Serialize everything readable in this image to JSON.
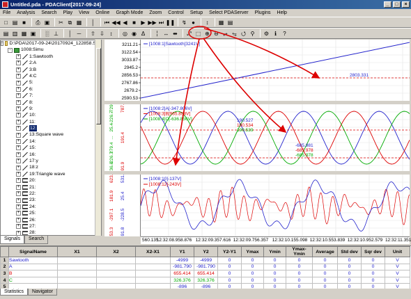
{
  "window": {
    "title": "Untitled.pda - PDAClient[2017-09-24]"
  },
  "menu": [
    "File",
    "Analysis",
    "Search",
    "Play",
    "View",
    "Online",
    "Graph Mode",
    "Zoom",
    "Control",
    "Setup",
    "Select PDAServer",
    "Plugins",
    "Help"
  ],
  "toolbar1": [
    {
      "name": "new-icon",
      "glyph": "□"
    },
    {
      "name": "open-icon",
      "glyph": "▤"
    },
    {
      "name": "save-icon",
      "glyph": "■"
    },
    {
      "name": "sep"
    },
    {
      "name": "print-icon",
      "glyph": "⎙"
    },
    {
      "name": "preview-icon",
      "glyph": "▣"
    },
    {
      "name": "sep"
    },
    {
      "name": "cut-icon",
      "glyph": "✂"
    },
    {
      "name": "copy-icon",
      "glyph": "⧉"
    },
    {
      "name": "paste-icon",
      "glyph": "▦"
    },
    {
      "name": "sep"
    },
    {
      "name": "marker-icon",
      "glyph": "│"
    },
    {
      "name": "sep"
    },
    {
      "name": "first-icon",
      "glyph": "⏮"
    },
    {
      "name": "rewind-icon",
      "glyph": "◀◀"
    },
    {
      "name": "prev-icon",
      "glyph": "◀"
    },
    {
      "name": "stop-icon",
      "glyph": "■"
    },
    {
      "name": "play-icon",
      "glyph": "▶"
    },
    {
      "name": "forward-icon",
      "glyph": "▶▶"
    },
    {
      "name": "last-icon",
      "glyph": "⏭"
    },
    {
      "name": "pause-icon",
      "glyph": "❚❚"
    },
    {
      "name": "sep"
    },
    {
      "name": "trigger-icon",
      "glyph": "↯"
    },
    {
      "name": "record-icon",
      "glyph": "●"
    },
    {
      "name": "sep"
    },
    {
      "name": "cursor-icon",
      "glyph": "↕"
    },
    {
      "name": "sep"
    },
    {
      "name": "grid-icon",
      "glyph": "▦"
    },
    {
      "name": "table-icon",
      "glyph": "▤"
    }
  ],
  "toolbar2": [
    {
      "name": "layout1-icon",
      "glyph": "▤"
    },
    {
      "name": "layout2-icon",
      "glyph": "▥"
    },
    {
      "name": "layout3-icon",
      "glyph": "▦"
    },
    {
      "name": "layout4-icon",
      "glyph": "▣"
    },
    {
      "name": "sep"
    },
    {
      "name": "chart-icon",
      "glyph": "░"
    },
    {
      "name": "xy-icon",
      "glyph": "⊥"
    },
    {
      "name": "sep"
    },
    {
      "name": "vertical-marker-icon",
      "glyph": "│"
    },
    {
      "name": "horizontal-marker-icon",
      "glyph": "─"
    },
    {
      "name": "sep"
    },
    {
      "name": "scale-up-icon",
      "glyph": "⇧"
    },
    {
      "name": "scale-down-icon",
      "glyph": "⇩"
    },
    {
      "name": "auto-scale-icon",
      "glyph": "↕"
    },
    {
      "name": "sep"
    },
    {
      "name": "time-marker-icon",
      "glyph": "◎"
    },
    {
      "name": "value-marker-icon",
      "glyph": "◉"
    },
    {
      "name": "delta-icon",
      "glyph": "Δ"
    },
    {
      "name": "sep"
    },
    {
      "name": "cursor-vertical-icon",
      "glyph": "╎"
    },
    {
      "name": "cursor-horizontal-icon",
      "glyph": "↔"
    },
    {
      "name": "cursor-cross-icon",
      "glyph": "⬌"
    },
    {
      "name": "sep"
    },
    {
      "name": "zoom-fit-icon",
      "glyph": "⤢"
    },
    {
      "name": "zoom-box-icon",
      "glyph": "⬚"
    },
    {
      "name": "zoom-in-icon",
      "glyph": "⊕"
    },
    {
      "name": "zoom-out-icon",
      "glyph": "⊖"
    },
    {
      "name": "zoom-x-icon",
      "glyph": "⥂"
    },
    {
      "name": "zoom-y-icon",
      "glyph": "⥃"
    },
    {
      "name": "zoom-reset-icon",
      "glyph": "⭯"
    },
    {
      "name": "search-icon",
      "glyph": "⚲"
    },
    {
      "name": "sep"
    },
    {
      "name": "settings-icon",
      "glyph": "⚙"
    },
    {
      "name": "info-icon",
      "glyph": "ℹ"
    },
    {
      "name": "help-icon",
      "glyph": "?"
    }
  ],
  "tree": {
    "root": "D:\\PDA\\2017-09-24\\20170924_122858.Sim",
    "node": "1008:Simu",
    "items": [
      {
        "label": "1:Sawtooth",
        "type": "analog"
      },
      {
        "label": "2:A",
        "type": "analog"
      },
      {
        "label": "3:B",
        "type": "analog"
      },
      {
        "label": "4:C",
        "type": "analog"
      },
      {
        "label": "5:",
        "type": "analog"
      },
      {
        "label": "6:",
        "type": "analog"
      },
      {
        "label": "7:",
        "type": "analog"
      },
      {
        "label": "8:",
        "type": "analog"
      },
      {
        "label": "9:",
        "type": "analog"
      },
      {
        "label": "10:",
        "type": "analog"
      },
      {
        "label": "11:",
        "type": "analog"
      },
      {
        "label": "12:",
        "type": "analog",
        "selected": true
      },
      {
        "label": "13:Square wave",
        "type": "analog"
      },
      {
        "label": "14:",
        "type": "analog"
      },
      {
        "label": "15:",
        "type": "analog"
      },
      {
        "label": "16:",
        "type": "analog"
      },
      {
        "label": "17:y",
        "type": "analog"
      },
      {
        "label": "18:z",
        "type": "analog"
      },
      {
        "label": "19:Triangle wave",
        "type": "analog"
      },
      {
        "label": "20:",
        "type": "digital"
      },
      {
        "label": "21:",
        "type": "digital"
      },
      {
        "label": "22:",
        "type": "digital"
      },
      {
        "label": "23:",
        "type": "digital"
      },
      {
        "label": "24:",
        "type": "digital"
      },
      {
        "label": "25:",
        "type": "digital"
      },
      {
        "label": "26:",
        "type": "digital"
      },
      {
        "label": "27:",
        "type": "digital"
      },
      {
        "label": "28:",
        "type": "digital"
      },
      {
        "label": "29:",
        "type": "digital"
      }
    ],
    "tabs": [
      "Signals",
      "Search"
    ]
  },
  "plot1": {
    "legend": "[1008:1]Sawtooth[3241V]",
    "ticks": [
      "3211.21",
      "3122.54",
      "3033.87",
      "2945.2",
      "2856.53",
      "2767.86",
      "2679.2",
      "2590.53"
    ],
    "marker_value": "2803.331",
    "colors": {
      "line": "#2222cc",
      "marker": "#dd0000",
      "arrow": "#dd0000"
    }
  },
  "plot2": {
    "legends": [
      {
        "text": "[1008:2]A[-347.806V]",
        "color": "#2222cc"
      },
      {
        "text": "[1008:3]B[965.858V]",
        "color": "#dd0000"
      },
      {
        "text": "[1008:4]C[-636.856V]",
        "color": "#00aa00"
      }
    ],
    "left_ticks": [
      "-736.8",
      "-226.7",
      "279.4",
      "...",
      "25.4",
      "-226.7",
      "-729.1"
    ],
    "center_ticks": [
      "-491.9",
      "191.4",
      "787.6"
    ],
    "readout_a": [
      {
        "text": "190.527",
        "color": "#2222cc"
      },
      {
        "text": "190.534",
        "color": "#dd0000"
      },
      {
        "text": "190.539",
        "color": "#00aa00"
      }
    ],
    "readout_b": [
      {
        "text": "-685.981",
        "color": "#2222cc"
      },
      {
        "text": "-685.978",
        "color": "#dd0000"
      },
      {
        "text": "-685.978",
        "color": "#00aa00"
      }
    ]
  },
  "plot3": {
    "legends": [
      {
        "text": "[1008:10]-137V]",
        "color": "#2222cc"
      },
      {
        "text": "[1008:12]-243V]",
        "color": "#dd0000"
      }
    ],
    "left_ticks": [
      "-753.3",
      "-297.1",
      "181.9",
      "623.8"
    ],
    "mid_ticks": [
      "-491.8",
      "-228.5",
      "25.4",
      "531.8"
    ]
  },
  "xaxis": [
    "560.135",
    "12:32:08.958.876",
    "12:32:09.357.616",
    "12:32:09.756.357",
    "12:32:10.155.098",
    "12:32:10.553.839",
    "12:32:10.952.579",
    "12:32:11.351.320"
  ],
  "table": {
    "columns": [
      "",
      "SignalName",
      "X1",
      "X2",
      "X2-X1",
      "Y1",
      "Y2",
      "Y2-Y1",
      "Ymax",
      "Ymin",
      "Ymax-Ymin",
      "Average",
      "Std dev",
      "Sqr dev",
      "Unit"
    ],
    "rows": [
      {
        "n": "1",
        "name": "Sawtooth",
        "color": "#2222cc",
        "x1": "",
        "x2": "",
        "dx": "",
        "y1": "-4999",
        "y2": "-4999",
        "dy": "0",
        "ymax": "0",
        "ymin": "0",
        "range": "0",
        "avg": "0",
        "std": "0",
        "sqr": "0",
        "unit": "V"
      },
      {
        "n": "2",
        "name": "A",
        "color": "#2222cc",
        "x1": "",
        "x2": "",
        "dx": "",
        "y1": "-981.790",
        "y2": "-981.790",
        "dy": "0",
        "ymax": "0",
        "ymin": "0",
        "range": "0",
        "avg": "0",
        "std": "0",
        "sqr": "0",
        "unit": "V"
      },
      {
        "n": "3",
        "name": "B",
        "color": "#dd0000",
        "x1": "",
        "x2": "",
        "dx": "",
        "y1": "655.414",
        "y2": "655.414",
        "dy": "0",
        "ymax": "0",
        "ymin": "0",
        "range": "0",
        "avg": "0",
        "std": "0",
        "sqr": "0",
        "unit": "V"
      },
      {
        "n": "4",
        "name": "C",
        "color": "#00aa00",
        "x1": "",
        "x2": "",
        "dx": "",
        "y1": "326.376",
        "y2": "326.376",
        "dy": "0",
        "ymax": "0",
        "ymin": "0",
        "range": "0",
        "avg": "0",
        "std": "0",
        "sqr": "0",
        "unit": "V"
      },
      {
        "n": "5",
        "name": "",
        "color": "#2222cc",
        "x1": "",
        "x2": "",
        "dx": "",
        "y1": "-896",
        "y2": "-896",
        "dy": "0",
        "ymax": "0",
        "ymin": "0",
        "range": "0",
        "avg": "0",
        "std": "0",
        "sqr": "0",
        "unit": "V"
      }
    ]
  },
  "bottom_tabs": [
    "Statistics",
    "Navigator"
  ]
}
